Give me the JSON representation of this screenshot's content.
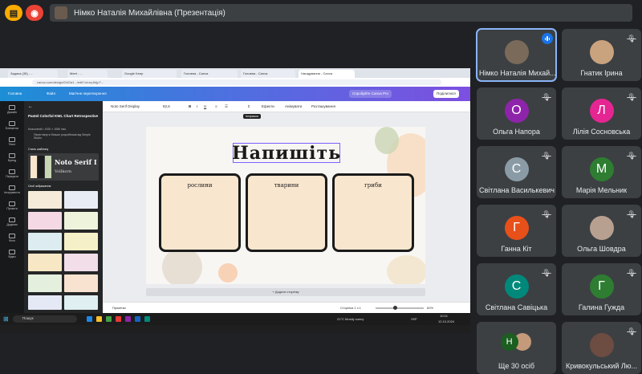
{
  "top_controls": {
    "present_text": "Німко Наталія Михайлівна (Презентація)"
  },
  "browser": {
    "tabs": [
      "Задача (35) - ...",
      "Meet - ...",
      "Google Keep",
      "Головна - Canva",
      "Головна - Canva",
      "Нагадування - Canva"
    ],
    "url": "canva.com/design/DAGa1.../edit?ui=eyJkIjp7..."
  },
  "canva": {
    "menu": [
      "Головна",
      "Файл",
      "Магічне перетворення"
    ],
    "share_label": "Поділитися",
    "trial_label": "Спробуйте Canva Pro",
    "rail": [
      "Дизайн",
      "Елементи",
      "Текст",
      "Бренд",
      "Передати",
      "Інструменти",
      "Проєкти",
      "Додатки",
      "Фото",
      "Відео"
    ],
    "panel": {
      "title": "Pastel Colorful KWL Chart Retrospective",
      "size": "Класичний • 1920 × 1080 пікс.",
      "author": "Переглянути більше розробників від Simple Studio",
      "styles_heading": "Стиль шаблону",
      "style_font_1": "Noto Serif I",
      "style_font_2": "Vollkorn",
      "all_images_heading": "Сесії зображення"
    },
    "toolbar": {
      "font": "Noto Serif Display",
      "size": "82,6",
      "effects": "Ефекти",
      "animate": "Анімувати",
      "position": "Розташування",
      "tooltip": "Інтервали"
    },
    "slide": {
      "title": "Напишіть",
      "cards": [
        "рослини",
        "тварини",
        "гриби"
      ]
    },
    "add_page": "+ Додати сторінку",
    "bottom": {
      "notes": "Примітки",
      "page": "Сторінка 1 з 1",
      "zoom": "60%"
    }
  },
  "taskbar": {
    "search": "Пошук",
    "weather": "21°C Mostly sunny",
    "lang": "УКР",
    "time": "10:01",
    "date": "12.10.2024"
  },
  "participants": [
    {
      "name": "Німко Наталія Михай...",
      "initial": "",
      "color": "#7a6a5a",
      "photo": true,
      "speaking": true
    },
    {
      "name": "Гнатик Ірина",
      "initial": "",
      "color": "#c9a27e",
      "photo": true,
      "speaking": false
    },
    {
      "name": "Ольга Напора",
      "initial": "О",
      "color": "#8e24aa",
      "photo": false,
      "speaking": false
    },
    {
      "name": "Лілія Сосновська",
      "initial": "Л",
      "color": "#e52592",
      "photo": false,
      "speaking": false
    },
    {
      "name": "Світлана Василькевич",
      "initial": "С",
      "color": "#8a9ba5",
      "photo": false,
      "speaking": false
    },
    {
      "name": "Марія Мельник",
      "initial": "М",
      "color": "#2e7d32",
      "photo": false,
      "speaking": false
    },
    {
      "name": "Ганна Кіт",
      "initial": "Г",
      "color": "#e8501a",
      "photo": false,
      "speaking": false
    },
    {
      "name": "Ольга Шовдра",
      "initial": "",
      "color": "#b8a090",
      "photo": true,
      "speaking": false
    },
    {
      "name": "Світлана Савіцька",
      "initial": "С",
      "color": "#00897b",
      "photo": false,
      "speaking": false
    },
    {
      "name": "Галина Гужда",
      "initial": "Г",
      "color": "#2e7d32",
      "photo": false,
      "speaking": false
    },
    {
      "name": "Ще 30 осіб",
      "initial": "Н",
      "color": "#1b5e20",
      "photo": false,
      "speaking": false
    },
    {
      "name": "Кривокульський Лю...",
      "initial": "",
      "color": "#6d4c41",
      "photo": true,
      "speaking": false
    }
  ]
}
